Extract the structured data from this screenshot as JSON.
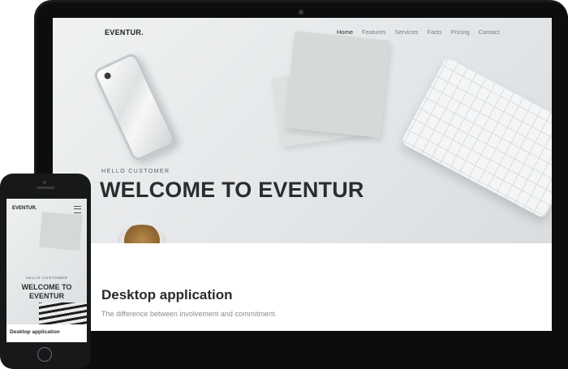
{
  "desktop": {
    "brand": "EVENTUR.",
    "nav": [
      {
        "label": "Home",
        "active": true
      },
      {
        "label": "Features",
        "active": false
      },
      {
        "label": "Services",
        "active": false
      },
      {
        "label": "Facts",
        "active": false
      },
      {
        "label": "Pricing",
        "active": false
      },
      {
        "label": "Contact",
        "active": false
      }
    ],
    "hero": {
      "eyebrow": "HELLO CUSTOMER",
      "title": "WELCOME TO EVENTUR"
    },
    "section": {
      "title": "Desktop application",
      "subtitle": "The difference between involvement and commitment."
    }
  },
  "mobile": {
    "brand": "EVENTUR.",
    "hero": {
      "eyebrow": "HELLO CUSTOMER",
      "title": "WELCOME TO EVENTUR"
    },
    "section": {
      "title": "Desktop application"
    }
  },
  "icons": [
    "menu-icon",
    "home-button-icon",
    "camera-icon"
  ]
}
